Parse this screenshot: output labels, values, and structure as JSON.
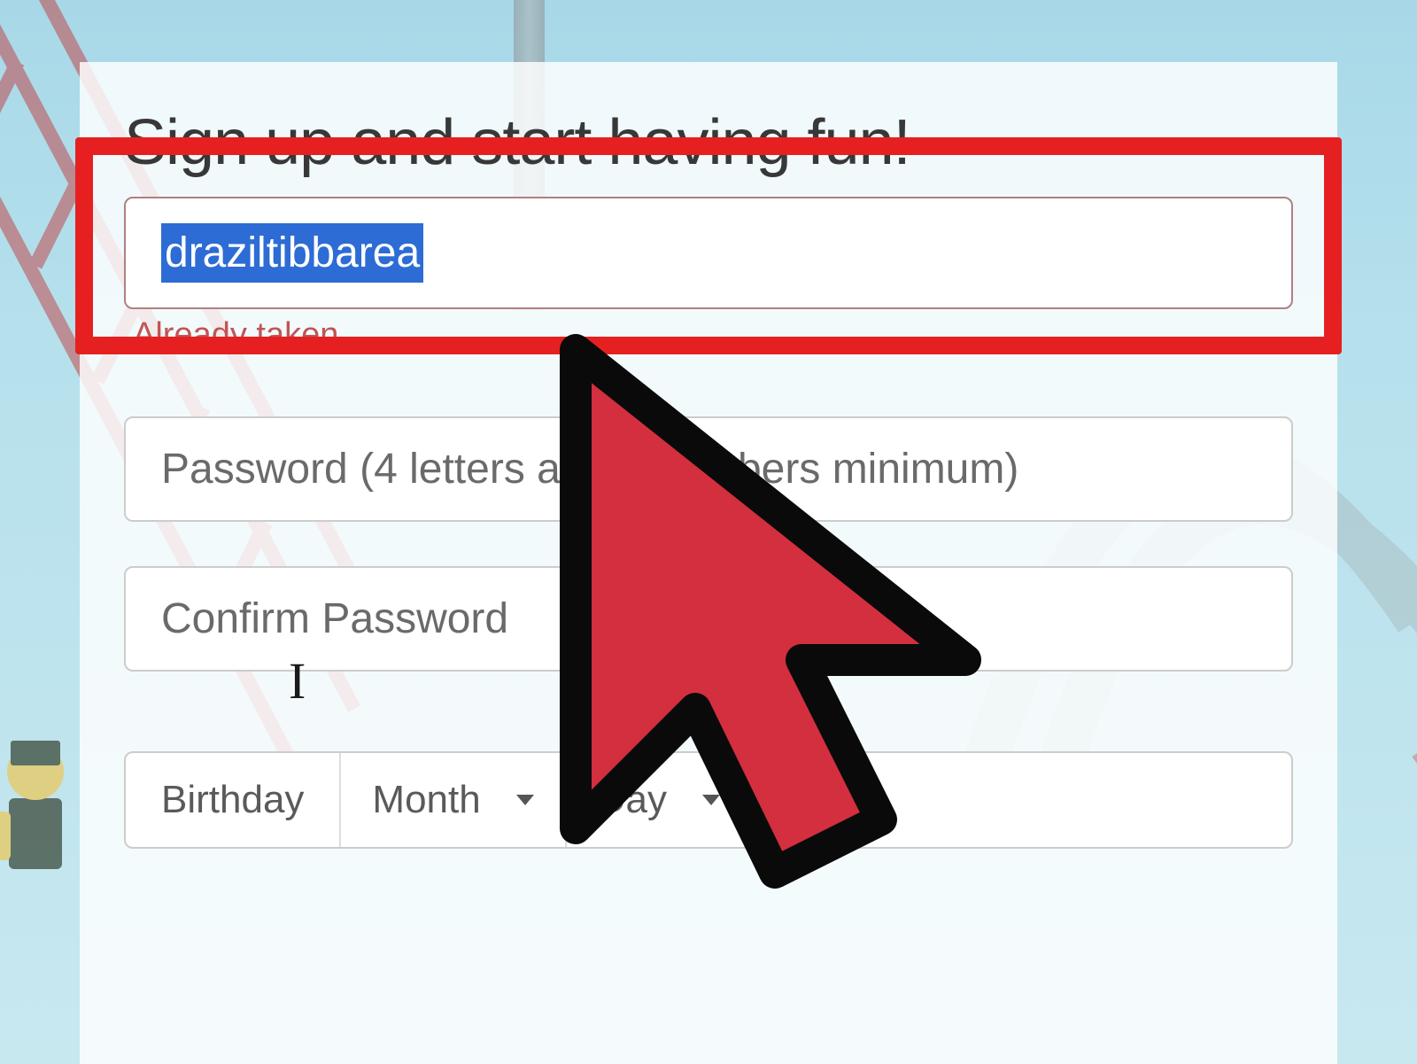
{
  "form": {
    "title": "Sign up and start having fun!",
    "username": {
      "value": "draziltibbarea",
      "validation_message": "Already taken"
    },
    "password": {
      "placeholder": "Password (4 letters and 2 numbers minimum)"
    },
    "confirm_password": {
      "placeholder": "Confirm Password"
    },
    "birthday": {
      "label": "Birthday",
      "month_label": "Month",
      "day_label": "Day"
    }
  },
  "colors": {
    "highlight": "#e62020",
    "selection": "#2c6cd4",
    "error_text": "#c05555"
  }
}
